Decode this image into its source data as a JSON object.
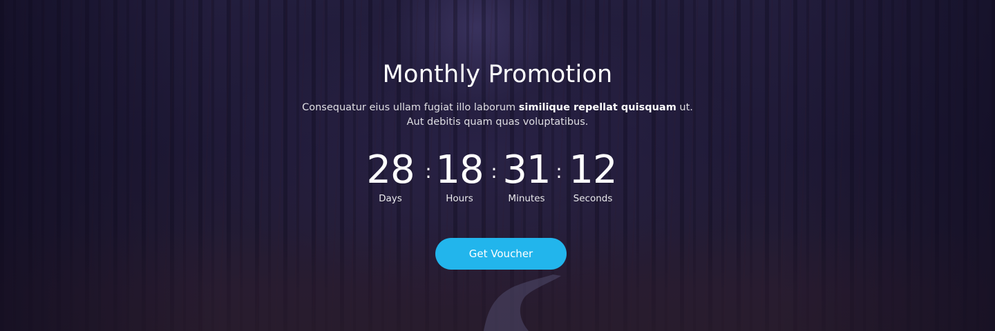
{
  "promo": {
    "title": "Monthly Promotion",
    "desc_line1_start": "Consequatur eius ullam fugiat illo laborum ",
    "desc_line1_bold": "similique repellat quisquam",
    "desc_line1_end": " ut.",
    "desc_line2": "Aut debitis  quam quas  voluptatibus."
  },
  "countdown": {
    "separator": ":",
    "days": {
      "value": "28",
      "label": "Days"
    },
    "hours": {
      "value": "18",
      "label": "Hours"
    },
    "minutes": {
      "value": "31",
      "label": "Minutes"
    },
    "seconds": {
      "value": "12",
      "label": "Seconds"
    }
  },
  "cta": {
    "label": "Get Voucher",
    "color": "#22b5ec"
  }
}
